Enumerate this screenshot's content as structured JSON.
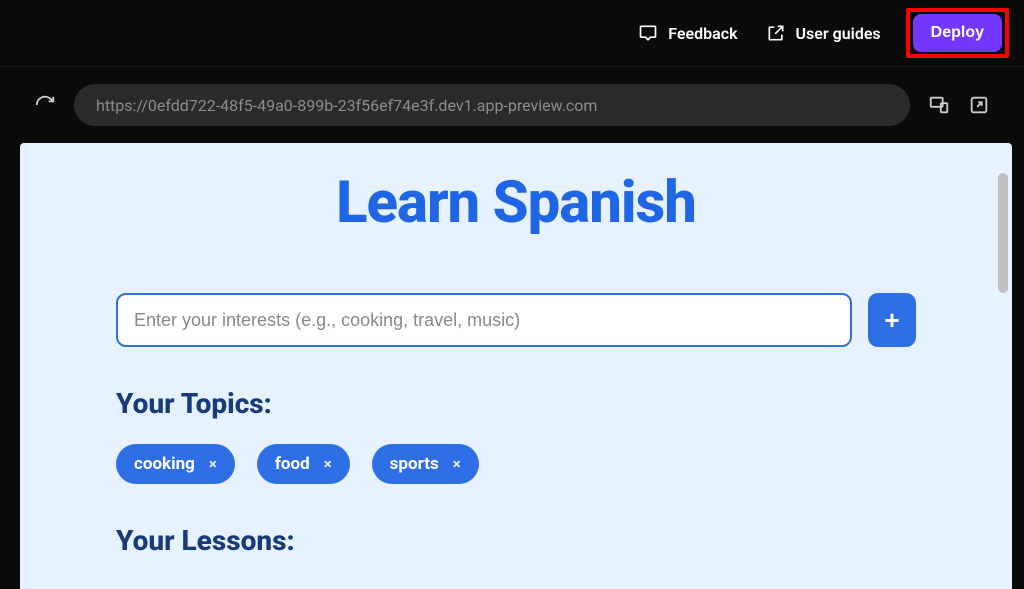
{
  "topbar": {
    "feedback_label": "Feedback",
    "guides_label": "User guides",
    "deploy_label": "Deploy"
  },
  "preview_toolbar": {
    "url": "https://0efdd722-48f5-49a0-899b-23f56ef74e3f.dev1.app-preview.com"
  },
  "app": {
    "title": "Learn Spanish",
    "interests_input": {
      "value": "",
      "placeholder": "Enter your interests (e.g., cooking, travel, music)"
    },
    "add_button_glyph": "+",
    "topics_heading": "Your Topics:",
    "topics": [
      {
        "label": "cooking"
      },
      {
        "label": "food"
      },
      {
        "label": "sports"
      }
    ],
    "chip_close_glyph": "×",
    "lessons_heading": "Your Lessons:"
  }
}
